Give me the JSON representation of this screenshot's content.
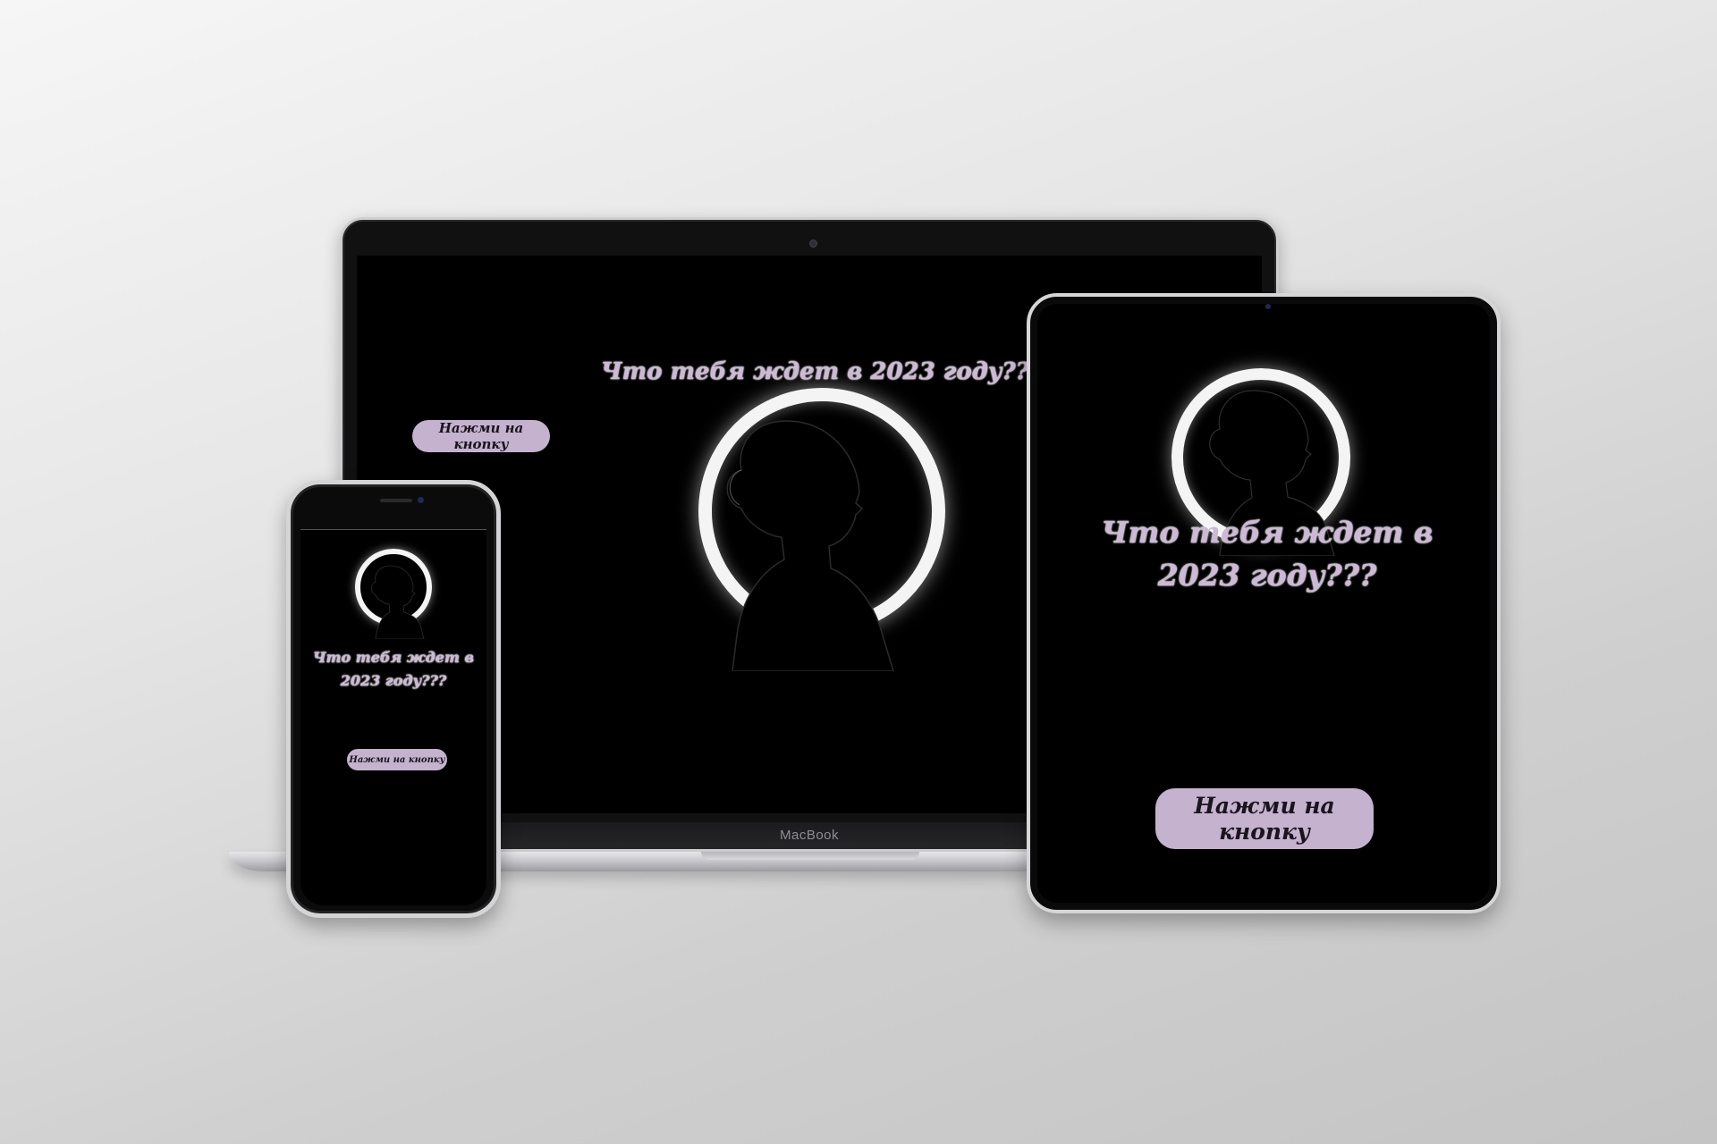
{
  "laptop": {
    "brand": "MacBook",
    "page": {
      "headline": "Что тебя ждет в 2023 году???",
      "button_label": "Нажми на кнопку"
    }
  },
  "tablet": {
    "page": {
      "headline": "Что тебя ждет в 2023 году???",
      "button_label": "Нажми на кнопку"
    }
  },
  "phone": {
    "page": {
      "headline": "Что тебя ждет в 2023 году???",
      "button_label": "Нажми на кнопку"
    }
  },
  "colors": {
    "background": "#e6e6e6",
    "screen": "#000000",
    "headline_text": "#cdb8d6",
    "button_fill": "#c4b2cf",
    "button_text": "#1a141d",
    "halo": "#f4f4f4"
  },
  "icons": [
    "camera-icon",
    "speaker-icon"
  ]
}
